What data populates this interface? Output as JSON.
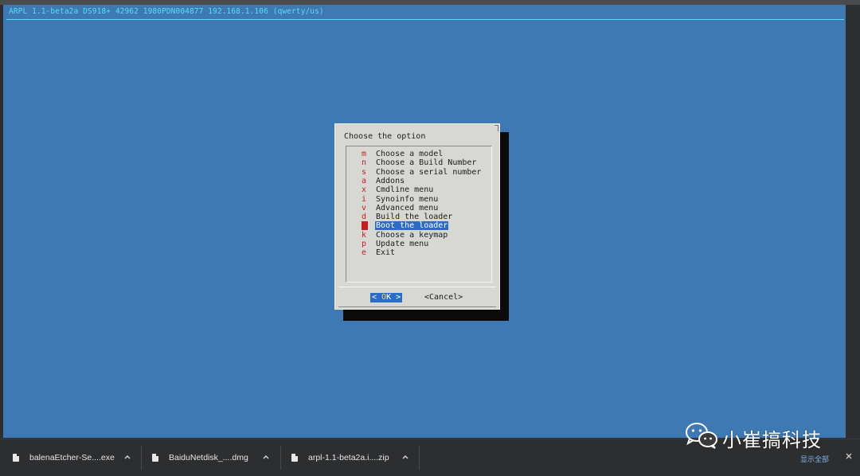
{
  "terminal": {
    "title": "ARPL 1.1-beta2a DS918+ 42962 1980PDN004877 192.168.1.106 (qwerty/us)",
    "background_color": "#3e79b3",
    "title_color": "#5bdcf5"
  },
  "dialog": {
    "title": "Choose the option",
    "items": [
      {
        "key": "m",
        "label": "Choose a model",
        "selected": false
      },
      {
        "key": "n",
        "label": "Choose a Build Number",
        "selected": false
      },
      {
        "key": "s",
        "label": "Choose a serial number",
        "selected": false
      },
      {
        "key": "a",
        "label": "Addons",
        "selected": false
      },
      {
        "key": "x",
        "label": "Cmdline menu",
        "selected": false
      },
      {
        "key": "i",
        "label": "Synoinfo menu",
        "selected": false
      },
      {
        "key": "v",
        "label": "Advanced menu",
        "selected": false
      },
      {
        "key": "d",
        "label": "Build the loader",
        "selected": false
      },
      {
        "key": "b",
        "label": "Boot the loader",
        "selected": true
      },
      {
        "key": "k",
        "label": "Choose a keymap",
        "selected": false
      },
      {
        "key": "p",
        "label": "Update menu",
        "selected": false
      },
      {
        "key": "e",
        "label": "Exit",
        "selected": false
      }
    ],
    "ok_left": "<  ",
    "ok_hot": "O",
    "ok_rest": "K  >",
    "cancel_label": "<Cancel>",
    "key_color": "#c41f1f",
    "selection_color": "#2b6cc4"
  },
  "downloads": {
    "items": [
      {
        "name": "balenaEtcher-Se....exe",
        "icon": "file-icon"
      },
      {
        "name": "BaiduNetdisk_....dmg",
        "icon": "file-icon"
      },
      {
        "name": "arpl-1.1-beta2a.i....zip",
        "icon": "file-icon"
      }
    ],
    "show_all_label": "显示全部",
    "close_icon": "close-icon"
  },
  "watermark": {
    "text": "小崔搞科技",
    "logo": "wechat-logo"
  }
}
